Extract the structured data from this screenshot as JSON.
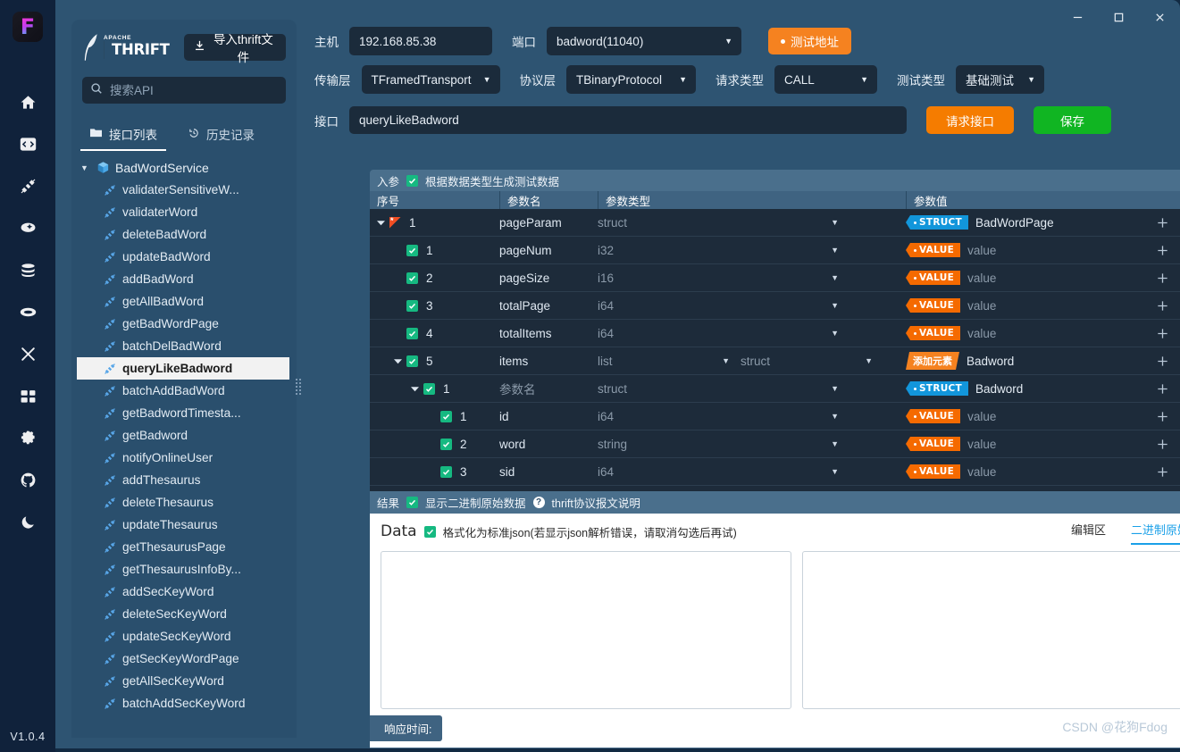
{
  "app": {
    "version": "V1.0.4",
    "logo_letter": "F"
  },
  "rail": {
    "items": [
      {
        "icon": "home-icon"
      },
      {
        "icon": "code-window-icon"
      },
      {
        "icon": "plug-icon"
      },
      {
        "icon": "magic-wand-icon"
      },
      {
        "icon": "database-icon"
      },
      {
        "icon": "oval-icon"
      },
      {
        "icon": "tools-icon"
      },
      {
        "icon": "grid-icon"
      },
      {
        "icon": "gear-icon"
      },
      {
        "icon": "github-icon"
      },
      {
        "icon": "moon-icon"
      }
    ]
  },
  "window": {
    "minimize": "–",
    "maximize": "□",
    "close": "✕"
  },
  "sidebar": {
    "brand": {
      "apache": "APACHE",
      "thrift": "THRIFT"
    },
    "import_button": "导入thrift文件",
    "search": {
      "placeholder": "搜索API",
      "value": ""
    },
    "tabs": [
      {
        "label": "接口列表",
        "icon": "folder-icon",
        "active": true
      },
      {
        "label": "历史记录",
        "icon": "history-icon",
        "active": false
      }
    ],
    "tree_root": "BadWordService",
    "tree_items": [
      "validaterSensitiveW...",
      "validaterWord",
      "deleteBadWord",
      "updateBadWord",
      "addBadWord",
      "getAllBadWord",
      "getBadWordPage",
      "batchDelBadWord",
      "queryLikeBadword",
      "batchAddBadWord",
      "getBadwordTimesta...",
      "getBadword",
      "notifyOnlineUser",
      "addThesaurus",
      "deleteThesaurus",
      "updateThesaurus",
      "getThesaurusPage",
      "getThesaurusInfoBy...",
      "addSecKeyWord",
      "deleteSecKeyWord",
      "updateSecKeyWord",
      "getSecKeyWordPage",
      "getAllSecKeyWord",
      "batchAddSecKeyWord"
    ],
    "selected_item": "queryLikeBadword"
  },
  "toolbar": {
    "host_label": "主机",
    "host_value": "192.168.85.38",
    "port_label": "端口",
    "port_value": "badword(11040)",
    "test_address_button": "测试地址",
    "transport_label": "传输层",
    "transport_value": "TFramedTransport",
    "protocol_label": "协议层",
    "protocol_value": "TBinaryProtocol",
    "request_type_label": "请求类型",
    "request_type_value": "CALL",
    "test_type_label": "测试类型",
    "test_type_value": "基础测试",
    "interface_label": "接口",
    "interface_value": "queryLikeBadword",
    "request_button": "请求接口",
    "save_button": "保存"
  },
  "params": {
    "section_label": "入参",
    "gen_checkbox_label": "根据数据类型生成测试数据",
    "gen_checked": true,
    "columns": [
      "序号",
      "参数名",
      "参数类型",
      "参数值"
    ],
    "rows": [
      {
        "indent": 0,
        "caret": "▼",
        "marker": "required",
        "index": "1",
        "name": "pageParam",
        "type": "struct",
        "type2": "",
        "badge": "STRUCT",
        "badge_kind": "struct",
        "value": "BadWordPage",
        "value_is_name": true
      },
      {
        "indent": 1,
        "caret": "",
        "marker": "check",
        "index": "1",
        "name": "pageNum",
        "type": "i32",
        "type2": "",
        "badge": "VALUE",
        "badge_kind": "value",
        "value": "value",
        "value_is_name": false
      },
      {
        "indent": 1,
        "caret": "",
        "marker": "check",
        "index": "2",
        "name": "pageSize",
        "type": "i16",
        "type2": "",
        "badge": "VALUE",
        "badge_kind": "value",
        "value": "value",
        "value_is_name": false
      },
      {
        "indent": 1,
        "caret": "",
        "marker": "check",
        "index": "3",
        "name": "totalPage",
        "type": "i64",
        "type2": "",
        "badge": "VALUE",
        "badge_kind": "value",
        "value": "value",
        "value_is_name": false
      },
      {
        "indent": 1,
        "caret": "",
        "marker": "check",
        "index": "4",
        "name": "totalItems",
        "type": "i64",
        "type2": "",
        "badge": "VALUE",
        "badge_kind": "value",
        "value": "value",
        "value_is_name": false
      },
      {
        "indent": 1,
        "caret": "▼",
        "marker": "check",
        "index": "5",
        "name": "items",
        "type": "list",
        "type2": "struct",
        "badge": "添加元素",
        "badge_kind": "addel",
        "value": "Badword",
        "value_is_name": true
      },
      {
        "indent": 2,
        "caret": "▼",
        "marker": "check",
        "index": "1",
        "name": "参数名",
        "name_is_placeholder": true,
        "type": "struct",
        "type2": "",
        "badge": "STRUCT",
        "badge_kind": "struct",
        "value": "Badword",
        "value_is_name": true
      },
      {
        "indent": 3,
        "caret": "",
        "marker": "check",
        "index": "1",
        "name": "id",
        "type": "i64",
        "type2": "",
        "badge": "VALUE",
        "badge_kind": "value",
        "value": "value",
        "value_is_name": false
      },
      {
        "indent": 3,
        "caret": "",
        "marker": "check",
        "index": "2",
        "name": "word",
        "type": "string",
        "type2": "",
        "badge": "VALUE",
        "badge_kind": "value",
        "value": "value",
        "value_is_name": false
      },
      {
        "indent": 3,
        "caret": "",
        "marker": "check",
        "index": "3",
        "name": "sid",
        "type": "i64",
        "type2": "",
        "badge": "VALUE",
        "badge_kind": "value",
        "value": "value",
        "value_is_name": false
      }
    ]
  },
  "result": {
    "section_label": "结果",
    "raw_checkbox_label": "显示二进制原始数据",
    "raw_checked": true,
    "help_text": "thrift协议报文说明",
    "data_title": "Data",
    "format_checkbox_label": "格式化为标准json(若显示json解析错误，请取消勾选后再试)",
    "format_checked": true,
    "tabs": [
      {
        "label": "编辑区",
        "active": false
      },
      {
        "label": "二进制原始数据",
        "active": true
      }
    ],
    "editor_value": "",
    "binary_value": "",
    "response_time_label": "响应时间:"
  },
  "watermark": "CSDN @花狗Fdog",
  "colors": {
    "accent_orange": "#f58220",
    "accent_green": "#10b522",
    "accent_blue": "#1296db",
    "checkbox_green": "#16b981",
    "panel_bg": "#2e5472"
  }
}
